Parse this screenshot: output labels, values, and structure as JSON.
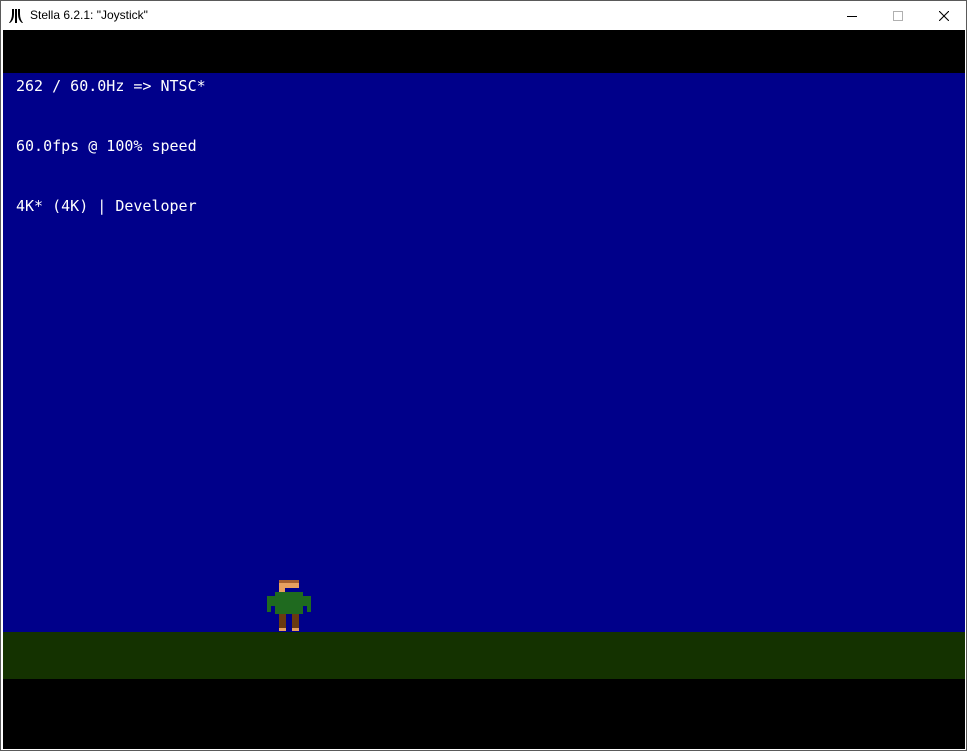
{
  "window": {
    "title": "Stella 6.2.1: \"Joystick\"",
    "app_icon": "atari-logo-icon",
    "controls": {
      "minimize": "minimize-icon",
      "maximize": "maximize-icon",
      "close": "close-icon"
    }
  },
  "overlay": {
    "line1": "262 / 60.0Hz => NTSC*",
    "line2": "60.0fps @ 100% speed",
    "line3": "4K* (4K) | Developer"
  },
  "game": {
    "sprite": "player-sprite",
    "colors": {
      "sky": "#00008a",
      "ground": "#143200",
      "border": "#000000",
      "player_skin": "#e8a060",
      "player_shirt": "#1f6a1f",
      "player_pants": "#6a3a10"
    }
  }
}
